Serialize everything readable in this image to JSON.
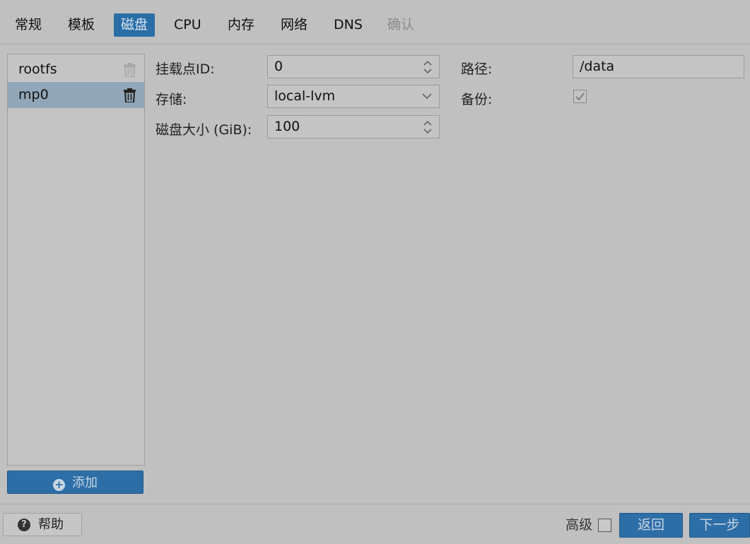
{
  "tabs": [
    "常规",
    "模板",
    "磁盘",
    "CPU",
    "内存",
    "网络",
    "DNS",
    "确认"
  ],
  "disks": [
    "rootfs",
    "mp0"
  ],
  "add_label": "添加",
  "form": {
    "mountpoint_id_label": "挂载点ID:",
    "mountpoint_id_value": "0",
    "storage_label": "存储:",
    "storage_value": "local-lvm",
    "disk_size_label": "磁盘大小 (GiB):",
    "disk_size_value": "100",
    "path_label": "路径:",
    "path_value": "/data",
    "backup_label": "备份:",
    "backup_checked": true
  },
  "footer": {
    "help_label": "帮助",
    "advanced_label": "高级",
    "advanced_checked": false,
    "back_label": "返回",
    "next_label": "下一步"
  },
  "colors": {
    "accent": "#2d6ea7",
    "selected_row": "#91a6b6",
    "background": "#c0c0c0"
  },
  "icons": [
    "trash-icon",
    "plus-circle-icon",
    "question-circle-icon",
    "spinner-arrows-icon",
    "chevron-down-icon",
    "checkmark-icon"
  ]
}
